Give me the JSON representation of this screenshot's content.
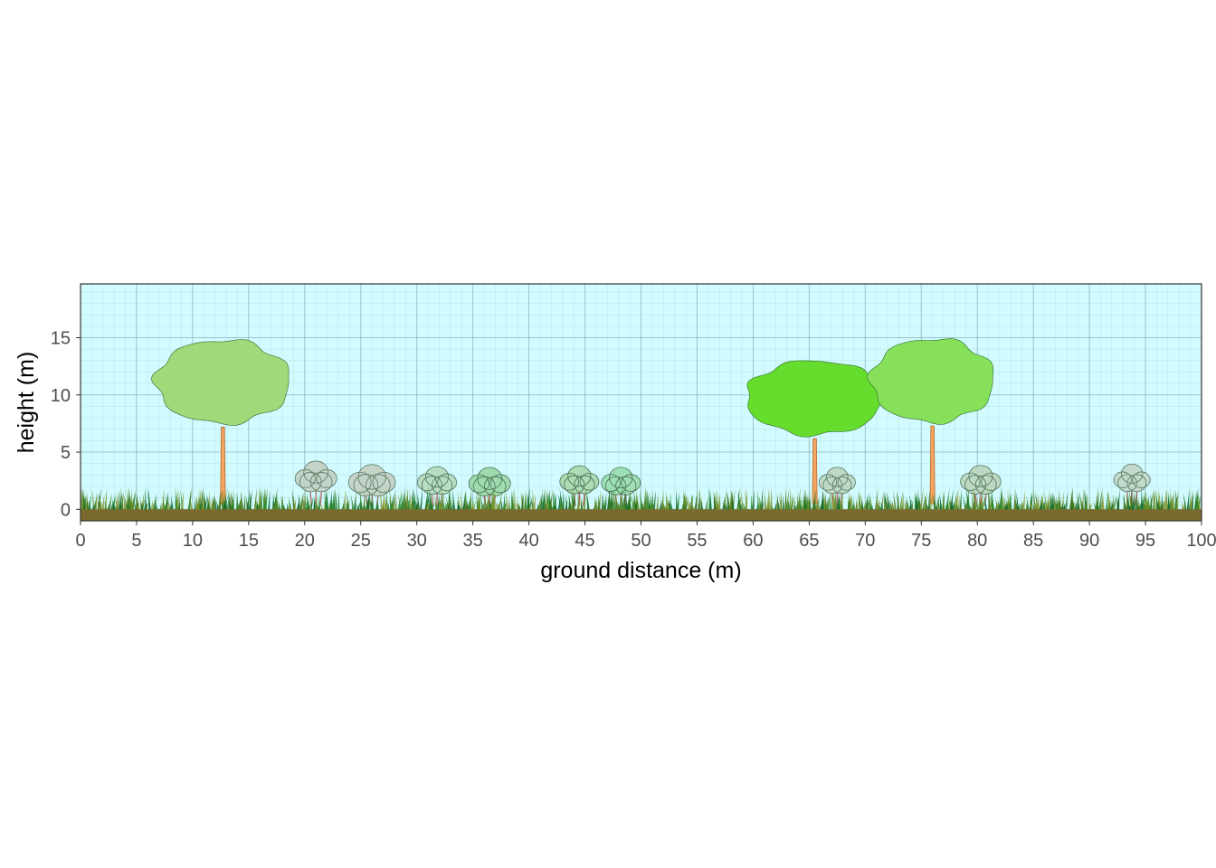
{
  "chart_data": {
    "type": "scatter",
    "title": "",
    "xlabel": "ground distance (m)",
    "ylabel": "height (m)",
    "xlim": [
      0,
      100
    ],
    "ylim": [
      -1,
      19.7
    ],
    "x_ticks": [
      0,
      5,
      10,
      15,
      20,
      25,
      30,
      35,
      40,
      45,
      50,
      55,
      60,
      65,
      70,
      75,
      80,
      85,
      90,
      95,
      100
    ],
    "y_ticks": [
      0,
      5,
      10,
      15
    ],
    "grid": true,
    "background_color": "#d2fbff",
    "ground_color": "#7a6a2e",
    "trees": [
      {
        "x": 12.7,
        "crown_base": 7.5,
        "crown_top": 14.8,
        "crown_width": 12.0,
        "crown_color": "#9ed97a",
        "trunk_color": "#f4a460",
        "opacity": 1.0
      },
      {
        "x": 65.5,
        "crown_base": 6.5,
        "crown_top": 13.0,
        "crown_width": 12.2,
        "crown_color": "#66dd2c",
        "trunk_color": "#f4a460",
        "opacity": 1.0
      },
      {
        "x": 76.0,
        "crown_base": 7.6,
        "crown_top": 14.9,
        "crown_width": 11.0,
        "crown_color": "#86e05a",
        "trunk_color": "#f4a460",
        "opacity": 1.0
      }
    ],
    "shrubs": [
      {
        "x": 21.0,
        "top": 4.4,
        "width": 3.2,
        "color": "#c4d0c4",
        "opacity": 0.9
      },
      {
        "x": 26.0,
        "top": 3.8,
        "width": 3.6,
        "color": "#c4d0c4",
        "opacity": 0.9
      },
      {
        "x": 31.8,
        "top": 3.8,
        "width": 3.0,
        "color": "#b6dcc0",
        "opacity": 0.95
      },
      {
        "x": 36.5,
        "top": 3.6,
        "width": 3.2,
        "color": "#9edcb0",
        "opacity": 1.0
      },
      {
        "x": 44.5,
        "top": 3.9,
        "width": 3.0,
        "color": "#acdcb4",
        "opacity": 1.0
      },
      {
        "x": 48.2,
        "top": 3.7,
        "width": 3.0,
        "color": "#9ee0b6",
        "opacity": 1.0
      },
      {
        "x": 67.5,
        "top": 3.8,
        "width": 2.8,
        "color": "#bed6c2",
        "opacity": 0.9
      },
      {
        "x": 80.3,
        "top": 3.9,
        "width": 3.1,
        "color": "#bcd8c0",
        "opacity": 0.95
      },
      {
        "x": 93.8,
        "top": 4.2,
        "width": 2.8,
        "color": "#c2d6c6",
        "opacity": 0.9
      }
    ],
    "grass": {
      "height": 1.8,
      "colors": [
        "#6b8e23",
        "#2e8b2e",
        "#1e6b1e",
        "#8a9a3a",
        "#4f7a1c",
        "#0b6b2b"
      ]
    }
  }
}
